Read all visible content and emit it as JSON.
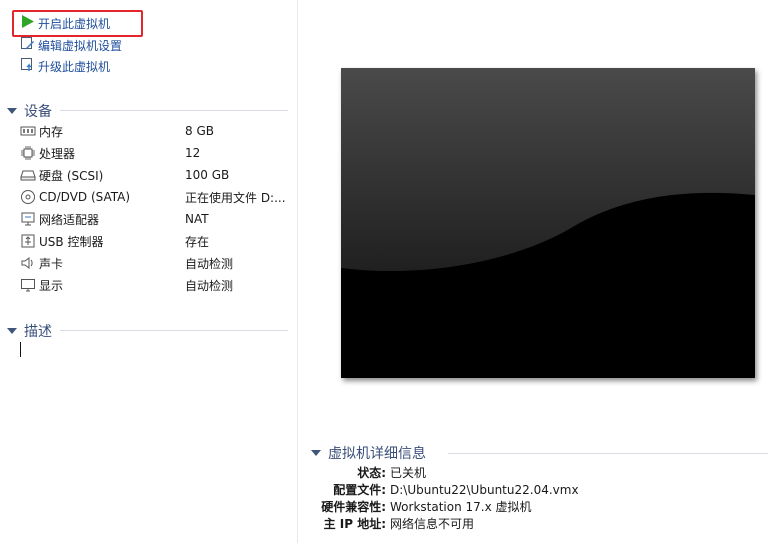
{
  "actions": [
    {
      "label": "开启此虚拟机",
      "icon": "play-icon"
    },
    {
      "label": "编辑虚拟机设置",
      "icon": "edit-settings-icon"
    },
    {
      "label": "升级此虚拟机",
      "icon": "upgrade-icon"
    }
  ],
  "devices_section": {
    "title": "设备",
    "items": [
      {
        "name": "内存",
        "value": "8 GB",
        "icon": "memory-icon"
      },
      {
        "name": "处理器",
        "value": "12",
        "icon": "processor-icon"
      },
      {
        "name": "硬盘 (SCSI)",
        "value": "100 GB",
        "icon": "hard-disk-icon"
      },
      {
        "name": "CD/DVD (SATA)",
        "value": "正在使用文件 D:...",
        "icon": "cd-dvd-icon"
      },
      {
        "name": "网络适配器",
        "value": "NAT",
        "icon": "network-adapter-icon"
      },
      {
        "name": "USB 控制器",
        "value": "存在",
        "icon": "usb-icon"
      },
      {
        "name": "声卡",
        "value": "自动检测",
        "icon": "sound-card-icon"
      },
      {
        "name": "显示",
        "value": "自动检测",
        "icon": "display-icon"
      }
    ]
  },
  "description_section": {
    "title": "描述"
  },
  "details_section": {
    "title": "虚拟机详细信息",
    "rows": [
      {
        "key": "状态:",
        "value": "已关机"
      },
      {
        "key": "配置文件:",
        "value": "D:\\Ubuntu22\\Ubuntu22.04.vmx"
      },
      {
        "key": "硬件兼容性:",
        "value": "Workstation 17.x 虚拟机"
      },
      {
        "key": "主 IP 地址:",
        "value": "网络信息不可用"
      }
    ]
  },
  "colors": {
    "accent_link": "#1f4e9c",
    "highlight_box": "#e3262b",
    "play_green": "#2fa52a"
  }
}
